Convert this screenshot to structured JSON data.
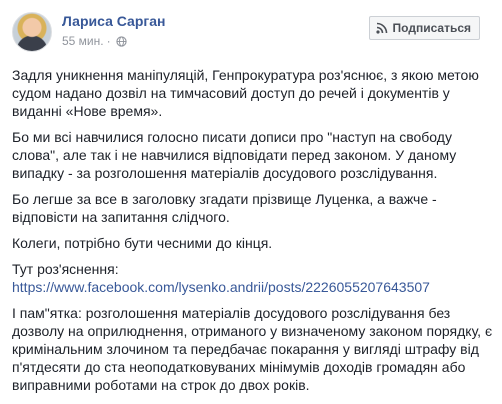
{
  "post": {
    "author": "Лариса Сарган",
    "time": "55 мин.",
    "subscribe_label": "Подписаться",
    "paragraphs": [
      "Задля уникнення маніпуляцій, Генпрокуратура роз'яснює, з якою метою судом надано дозвіл на тимчасовий доступ до речей і документів у виданні «Нове время».",
      "Бо ми всі навчилися голосно писати дописи про \"наступ на свободу слова\", але так і не навчилися відповідати перед законом. У даному випадку - за розголошення матеріалів досудового розслідування.",
      "Бо легше за все в заголовку згадати прізвище Луценка, а важче - відповісти на запитання слідчого.",
      "Колеги, потрібно бути чесними до кінця."
    ],
    "explanation_label": "Тут роз'яснення:",
    "link": "https://www.facebook.com/lysenko.andrii/posts/2226055207643507",
    "final_paragraph": "І пам\"ятка: розголошення матеріалів досудового розслідування без дозволу на оприлюднення, отриманого у визначеному законом порядку, є кримінальним злочином та передбачає покарання у вигляді штрафу від п'ятдесяти до ста неоподатковуваних мінімумів доходів громадян або виправними роботами на строк до двох років."
  },
  "colors": {
    "link": "#385898",
    "text": "#1d2129",
    "meta": "#90949c",
    "button_bg": "#f5f6f7"
  },
  "icons": {
    "avatar": "avatar",
    "privacy": "globe-icon",
    "subscribe": "rss-icon"
  }
}
